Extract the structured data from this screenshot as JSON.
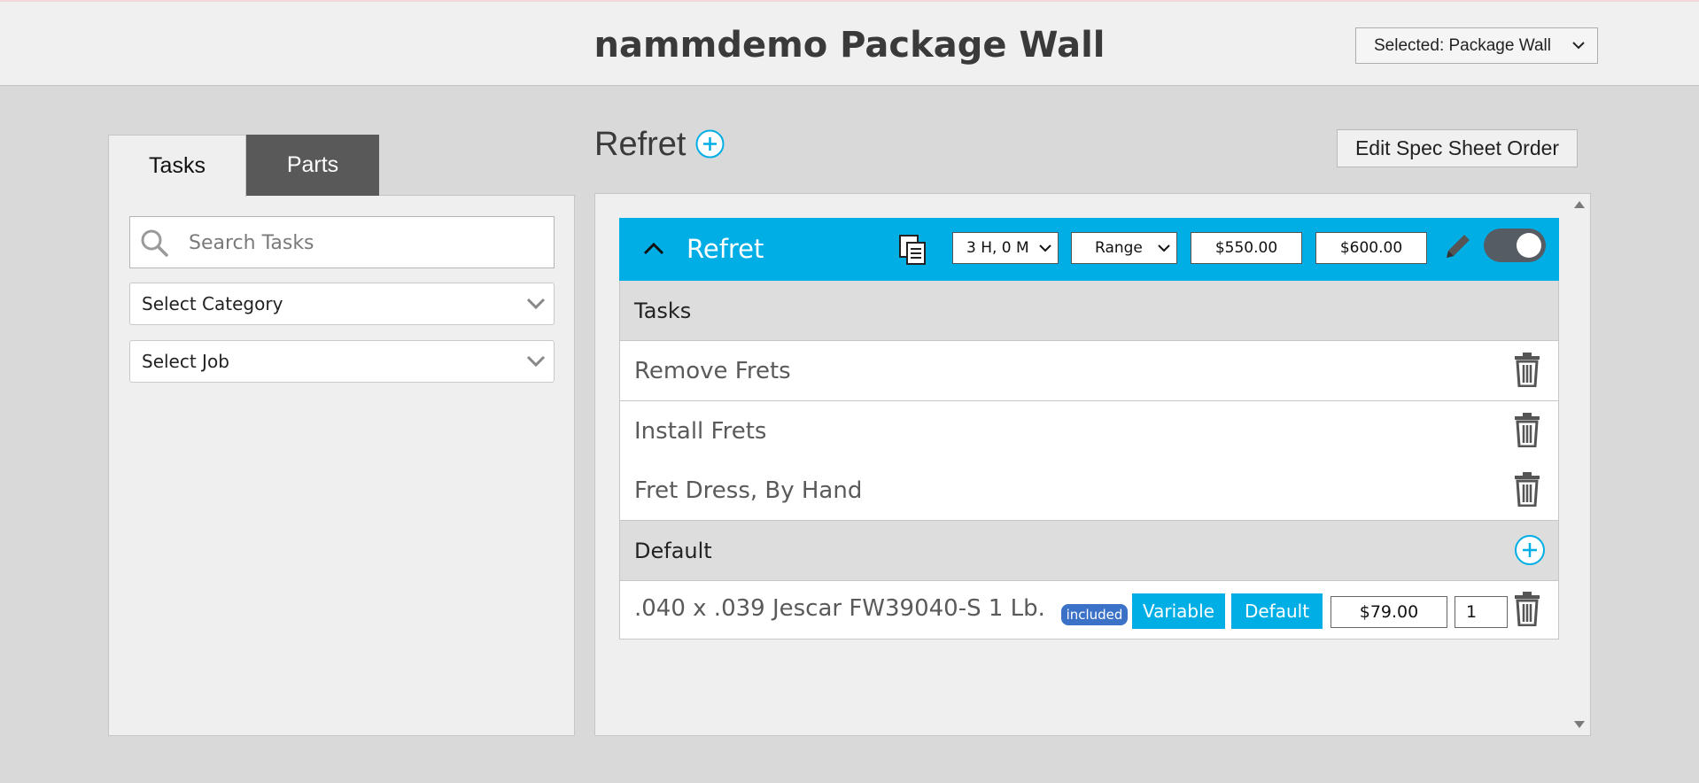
{
  "header": {
    "title": "nammdemo Package Wall",
    "view_selector": {
      "selected": "Selected: Package Wall"
    }
  },
  "sidebar": {
    "tabs": [
      {
        "label": "Tasks",
        "active": true
      },
      {
        "label": "Parts",
        "active": false
      }
    ],
    "search": {
      "placeholder": "Search Tasks",
      "value": ""
    },
    "category_select": {
      "selected": "Select Category"
    },
    "job_select": {
      "selected": "Select Job"
    }
  },
  "main": {
    "section_title": "Refret",
    "edit_order_label": "Edit Spec Sheet Order",
    "package": {
      "name": "Refret",
      "time": "3 H, 0 M",
      "price_type": "Range",
      "price_low": "$550.00",
      "price_high": "$600.00",
      "enabled": true,
      "task_group_label": "Tasks",
      "tasks": [
        {
          "name": "Remove Frets"
        },
        {
          "name": "Install Frets"
        },
        {
          "name": "Fret Dress, By Hand"
        }
      ],
      "part_group_label": "Default",
      "parts": [
        {
          "name": ".040 x .039 Jescar FW39040-S 1 Lb.",
          "badge": "included",
          "variable_label": "Variable",
          "default_label": "Default",
          "price": "$79.00",
          "qty": "1"
        }
      ]
    }
  },
  "colors": {
    "accent": "#00aee6",
    "badge": "#3b72c8",
    "tab_inactive": "#595959",
    "background": "#d9d9d9"
  },
  "icons": [
    "chevron-down-icon",
    "search-icon",
    "add-circle-icon",
    "chevron-up-icon",
    "copy-icon",
    "pencil-icon",
    "toggle-switch",
    "trash-icon",
    "scroll-up-icon",
    "scroll-down-icon"
  ]
}
